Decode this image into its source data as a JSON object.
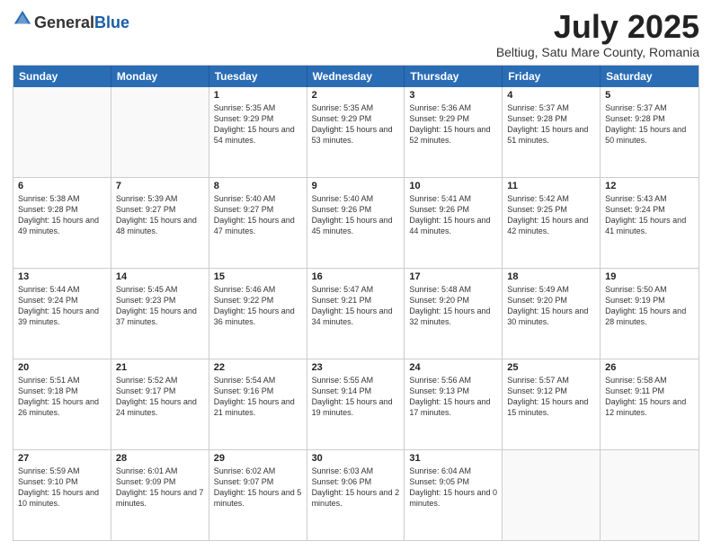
{
  "header": {
    "logo_general": "General",
    "logo_blue": "Blue",
    "month_title": "July 2025",
    "location": "Beltiug, Satu Mare County, Romania"
  },
  "days_of_week": [
    "Sunday",
    "Monday",
    "Tuesday",
    "Wednesday",
    "Thursday",
    "Friday",
    "Saturday"
  ],
  "weeks": [
    [
      {
        "day": "",
        "empty": true
      },
      {
        "day": "",
        "empty": true
      },
      {
        "day": "1",
        "sunrise": "Sunrise: 5:35 AM",
        "sunset": "Sunset: 9:29 PM",
        "daylight": "Daylight: 15 hours and 54 minutes."
      },
      {
        "day": "2",
        "sunrise": "Sunrise: 5:35 AM",
        "sunset": "Sunset: 9:29 PM",
        "daylight": "Daylight: 15 hours and 53 minutes."
      },
      {
        "day": "3",
        "sunrise": "Sunrise: 5:36 AM",
        "sunset": "Sunset: 9:29 PM",
        "daylight": "Daylight: 15 hours and 52 minutes."
      },
      {
        "day": "4",
        "sunrise": "Sunrise: 5:37 AM",
        "sunset": "Sunset: 9:28 PM",
        "daylight": "Daylight: 15 hours and 51 minutes."
      },
      {
        "day": "5",
        "sunrise": "Sunrise: 5:37 AM",
        "sunset": "Sunset: 9:28 PM",
        "daylight": "Daylight: 15 hours and 50 minutes."
      }
    ],
    [
      {
        "day": "6",
        "sunrise": "Sunrise: 5:38 AM",
        "sunset": "Sunset: 9:28 PM",
        "daylight": "Daylight: 15 hours and 49 minutes."
      },
      {
        "day": "7",
        "sunrise": "Sunrise: 5:39 AM",
        "sunset": "Sunset: 9:27 PM",
        "daylight": "Daylight: 15 hours and 48 minutes."
      },
      {
        "day": "8",
        "sunrise": "Sunrise: 5:40 AM",
        "sunset": "Sunset: 9:27 PM",
        "daylight": "Daylight: 15 hours and 47 minutes."
      },
      {
        "day": "9",
        "sunrise": "Sunrise: 5:40 AM",
        "sunset": "Sunset: 9:26 PM",
        "daylight": "Daylight: 15 hours and 45 minutes."
      },
      {
        "day": "10",
        "sunrise": "Sunrise: 5:41 AM",
        "sunset": "Sunset: 9:26 PM",
        "daylight": "Daylight: 15 hours and 44 minutes."
      },
      {
        "day": "11",
        "sunrise": "Sunrise: 5:42 AM",
        "sunset": "Sunset: 9:25 PM",
        "daylight": "Daylight: 15 hours and 42 minutes."
      },
      {
        "day": "12",
        "sunrise": "Sunrise: 5:43 AM",
        "sunset": "Sunset: 9:24 PM",
        "daylight": "Daylight: 15 hours and 41 minutes."
      }
    ],
    [
      {
        "day": "13",
        "sunrise": "Sunrise: 5:44 AM",
        "sunset": "Sunset: 9:24 PM",
        "daylight": "Daylight: 15 hours and 39 minutes."
      },
      {
        "day": "14",
        "sunrise": "Sunrise: 5:45 AM",
        "sunset": "Sunset: 9:23 PM",
        "daylight": "Daylight: 15 hours and 37 minutes."
      },
      {
        "day": "15",
        "sunrise": "Sunrise: 5:46 AM",
        "sunset": "Sunset: 9:22 PM",
        "daylight": "Daylight: 15 hours and 36 minutes."
      },
      {
        "day": "16",
        "sunrise": "Sunrise: 5:47 AM",
        "sunset": "Sunset: 9:21 PM",
        "daylight": "Daylight: 15 hours and 34 minutes."
      },
      {
        "day": "17",
        "sunrise": "Sunrise: 5:48 AM",
        "sunset": "Sunset: 9:20 PM",
        "daylight": "Daylight: 15 hours and 32 minutes."
      },
      {
        "day": "18",
        "sunrise": "Sunrise: 5:49 AM",
        "sunset": "Sunset: 9:20 PM",
        "daylight": "Daylight: 15 hours and 30 minutes."
      },
      {
        "day": "19",
        "sunrise": "Sunrise: 5:50 AM",
        "sunset": "Sunset: 9:19 PM",
        "daylight": "Daylight: 15 hours and 28 minutes."
      }
    ],
    [
      {
        "day": "20",
        "sunrise": "Sunrise: 5:51 AM",
        "sunset": "Sunset: 9:18 PM",
        "daylight": "Daylight: 15 hours and 26 minutes."
      },
      {
        "day": "21",
        "sunrise": "Sunrise: 5:52 AM",
        "sunset": "Sunset: 9:17 PM",
        "daylight": "Daylight: 15 hours and 24 minutes."
      },
      {
        "day": "22",
        "sunrise": "Sunrise: 5:54 AM",
        "sunset": "Sunset: 9:16 PM",
        "daylight": "Daylight: 15 hours and 21 minutes."
      },
      {
        "day": "23",
        "sunrise": "Sunrise: 5:55 AM",
        "sunset": "Sunset: 9:14 PM",
        "daylight": "Daylight: 15 hours and 19 minutes."
      },
      {
        "day": "24",
        "sunrise": "Sunrise: 5:56 AM",
        "sunset": "Sunset: 9:13 PM",
        "daylight": "Daylight: 15 hours and 17 minutes."
      },
      {
        "day": "25",
        "sunrise": "Sunrise: 5:57 AM",
        "sunset": "Sunset: 9:12 PM",
        "daylight": "Daylight: 15 hours and 15 minutes."
      },
      {
        "day": "26",
        "sunrise": "Sunrise: 5:58 AM",
        "sunset": "Sunset: 9:11 PM",
        "daylight": "Daylight: 15 hours and 12 minutes."
      }
    ],
    [
      {
        "day": "27",
        "sunrise": "Sunrise: 5:59 AM",
        "sunset": "Sunset: 9:10 PM",
        "daylight": "Daylight: 15 hours and 10 minutes."
      },
      {
        "day": "28",
        "sunrise": "Sunrise: 6:01 AM",
        "sunset": "Sunset: 9:09 PM",
        "daylight": "Daylight: 15 hours and 7 minutes."
      },
      {
        "day": "29",
        "sunrise": "Sunrise: 6:02 AM",
        "sunset": "Sunset: 9:07 PM",
        "daylight": "Daylight: 15 hours and 5 minutes."
      },
      {
        "day": "30",
        "sunrise": "Sunrise: 6:03 AM",
        "sunset": "Sunset: 9:06 PM",
        "daylight": "Daylight: 15 hours and 2 minutes."
      },
      {
        "day": "31",
        "sunrise": "Sunrise: 6:04 AM",
        "sunset": "Sunset: 9:05 PM",
        "daylight": "Daylight: 15 hours and 0 minutes."
      },
      {
        "day": "",
        "empty": true
      },
      {
        "day": "",
        "empty": true
      }
    ]
  ]
}
